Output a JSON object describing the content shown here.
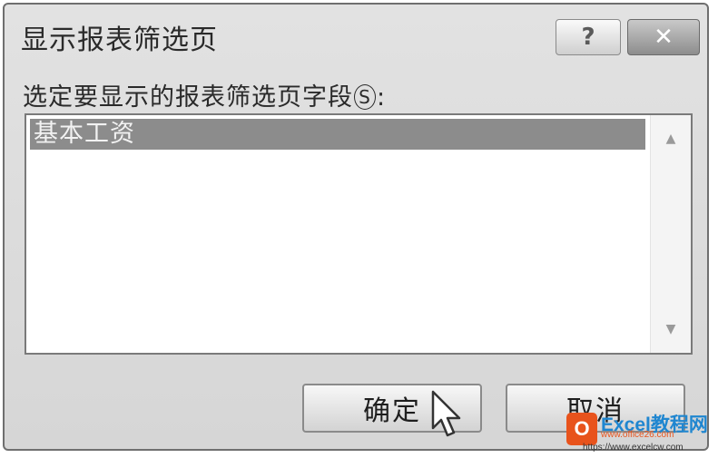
{
  "dialog": {
    "title": "显示报表筛选页",
    "help_symbol": "?",
    "close_symbol": "✕",
    "prompt_before": "选定要显示的报表筛选页字段",
    "prompt_accel": "S",
    "prompt_after": ":",
    "fields": [
      {
        "label": "基本工资",
        "selected": true
      }
    ],
    "ok_label": "确定",
    "cancel_label": "取消"
  },
  "scroll": {
    "up_symbol": "▲",
    "down_symbol": "▼"
  },
  "watermark": {
    "logo": "O",
    "title": "Excel教程网",
    "subtitle": "www.office26.com",
    "url": "https://www.excelcw.com"
  },
  "colors": {
    "selection": "#8c8c8c",
    "dialog_bg": "#d9d9d9",
    "brand_orange": "#e8531c",
    "brand_blue": "#1f86d0"
  }
}
